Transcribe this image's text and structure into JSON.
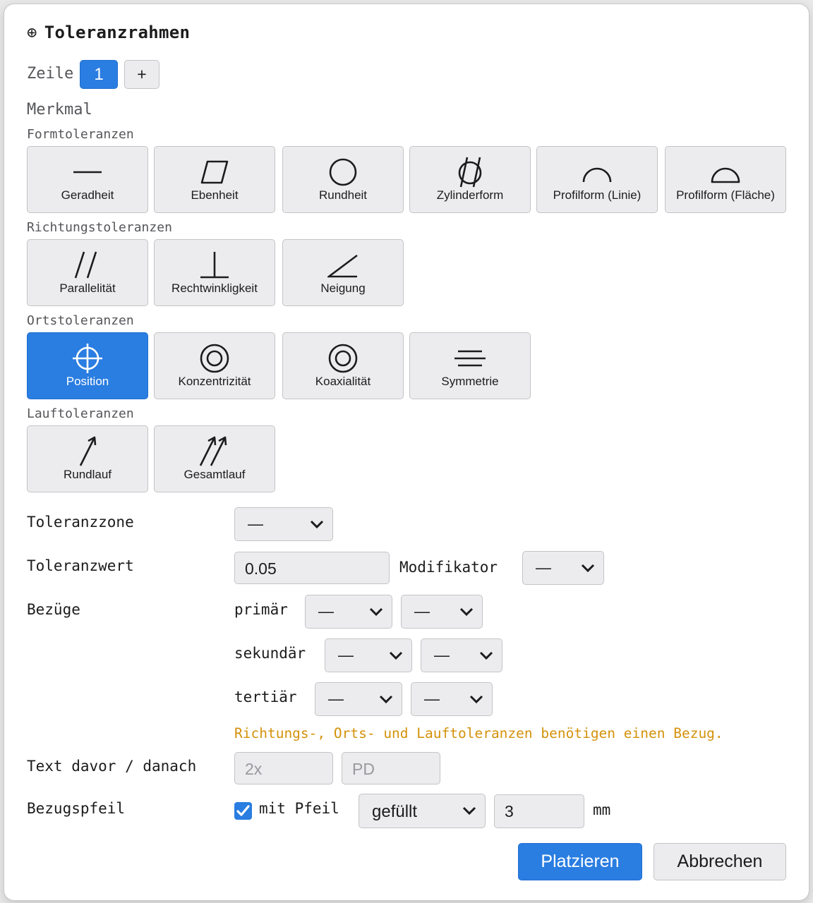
{
  "dialog": {
    "title_symbol": "⊕",
    "title": "Toleranzrahmen"
  },
  "zeile": {
    "label": "Zeile",
    "active_row": "1",
    "add_label": "+"
  },
  "merkmal_label": "Merkmal",
  "groups": {
    "form": {
      "label": "Formtoleranzen",
      "items": [
        {
          "label": "Geradheit",
          "icon": "straightness-icon"
        },
        {
          "label": "Ebenheit",
          "icon": "flatness-icon"
        },
        {
          "label": "Rundheit",
          "icon": "circularity-icon"
        },
        {
          "label": "Zylinderform",
          "icon": "cylindricity-icon"
        },
        {
          "label": "Profilform (Linie)",
          "icon": "line-profile-icon"
        },
        {
          "label": "Profilform (Fläche)",
          "icon": "surface-profile-icon"
        }
      ]
    },
    "richtung": {
      "label": "Richtungstoleranzen",
      "items": [
        {
          "label": "Parallelität",
          "icon": "parallelism-icon"
        },
        {
          "label": "Rechtwinkligkeit",
          "icon": "perpendicularity-icon"
        },
        {
          "label": "Neigung",
          "icon": "angularity-icon"
        }
      ]
    },
    "ort": {
      "label": "Ortstoleranzen",
      "items": [
        {
          "label": "Position",
          "icon": "position-icon",
          "selected": true
        },
        {
          "label": "Konzentrizität",
          "icon": "concentricity-icon"
        },
        {
          "label": "Koaxialität",
          "icon": "coaxiality-icon"
        },
        {
          "label": "Symmetrie",
          "icon": "symmetry-icon"
        }
      ]
    },
    "lauf": {
      "label": "Lauftoleranzen",
      "items": [
        {
          "label": "Rundlauf",
          "icon": "circular-runout-icon"
        },
        {
          "label": "Gesamtlauf",
          "icon": "total-runout-icon"
        }
      ]
    }
  },
  "form_fields": {
    "toleranzzone": {
      "label": "Toleranzzone",
      "value": "—"
    },
    "toleranzwert": {
      "label": "Toleranzwert",
      "value": "0.05"
    },
    "modifikator": {
      "label": "Modifikator",
      "value": "—"
    },
    "bezuege": {
      "label": "Bezüge",
      "primaer": {
        "label": "primär",
        "datum": "—",
        "modifier": "—"
      },
      "sekundaer": {
        "label": "sekundär",
        "datum": "—",
        "modifier": "—"
      },
      "tertiaer": {
        "label": "tertiär",
        "datum": "—",
        "modifier": "—"
      }
    },
    "warning": "Richtungs-, Orts- und Lauftoleranzen benötigen einen Bezug.",
    "text_davor_danach": {
      "label": "Text davor / danach",
      "before_placeholder": "2x",
      "after_placeholder": "PD"
    },
    "bezugspfeil": {
      "label": "Bezugspfeil",
      "checkbox_label": "mit Pfeil",
      "checked": true,
      "style": "gefüllt",
      "size": "3",
      "unit": "mm"
    }
  },
  "actions": {
    "place": "Platzieren",
    "cancel": "Abbrechen"
  },
  "colors": {
    "accent": "#2a7de1",
    "warning": "#d4920b",
    "button_bg": "#ececee"
  }
}
